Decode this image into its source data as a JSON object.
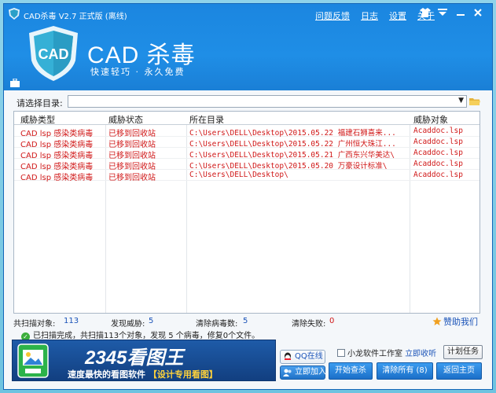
{
  "window": {
    "title": "CAD杀毒 V2.7 正式版 (离线)",
    "links": [
      "问题反馈",
      "日志",
      "设置",
      "关于"
    ],
    "accent": "#1f8ee6"
  },
  "header": {
    "logo_text": "CAD",
    "brand": "CAD 杀毒",
    "slogan": "快速轻巧 · 永久免费"
  },
  "directory": {
    "label": "请选择目录:",
    "value": ""
  },
  "table": {
    "columns": [
      "威胁类型",
      "威胁状态",
      "所在目录",
      "威胁对象"
    ],
    "rows": [
      {
        "type": "CAD lsp 感染类病毒",
        "status": "已移到回收站",
        "path": "C:\\Users\\DELL\\Desktop\\2015.05.22 福建石狮喜来...",
        "object": "Acaddoc.lsp"
      },
      {
        "type": "CAD lsp 感染类病毒",
        "status": "已移到回收站",
        "path": "C:\\Users\\DELL\\Desktop\\2015.05.22 广州恒大珠江...",
        "object": "Acaddoc.lsp"
      },
      {
        "type": "CAD lsp 感染类病毒",
        "status": "已移到回收站",
        "path": "C:\\Users\\DELL\\Desktop\\2015.05.21 广西东兴华美达\\",
        "object": "Acaddoc.lsp"
      },
      {
        "type": "CAD lsp 感染类病毒",
        "status": "已移到回收站",
        "path": "C:\\Users\\DELL\\Desktop\\2015.05.20 万豪设计标准\\",
        "object": "Acaddoc.lsp"
      },
      {
        "type": "CAD lsp 感染类病毒",
        "status": "已移到回收站",
        "path": "C:\\Users\\DELL\\Desktop\\",
        "object": "Acaddoc.lsp"
      }
    ]
  },
  "stats": {
    "scanned_label": "共扫描对象:",
    "scanned": "113",
    "threats_label": "发现威胁:",
    "threats": "5",
    "cleaned_label": "清除病毒数:",
    "cleaned": "5",
    "failed_label": "清除失败:",
    "failed": "0",
    "help": "赞助我们"
  },
  "scan_message": "已扫描完成，共扫描113个对象，发现 5 个病毒，修复0个文件。",
  "banner": {
    "title": "2345看图王",
    "subtitle": "速度最快的看图软件",
    "tag": "【设计专用看图】"
  },
  "buttons": {
    "qq": "QQ在线",
    "join": "立即加入",
    "studio": "小龙软件工作室",
    "studio_link": "立即收听",
    "task": "计划任务",
    "start": "开始查杀",
    "clear": "清除所有 (8)",
    "home": "返回主页"
  }
}
